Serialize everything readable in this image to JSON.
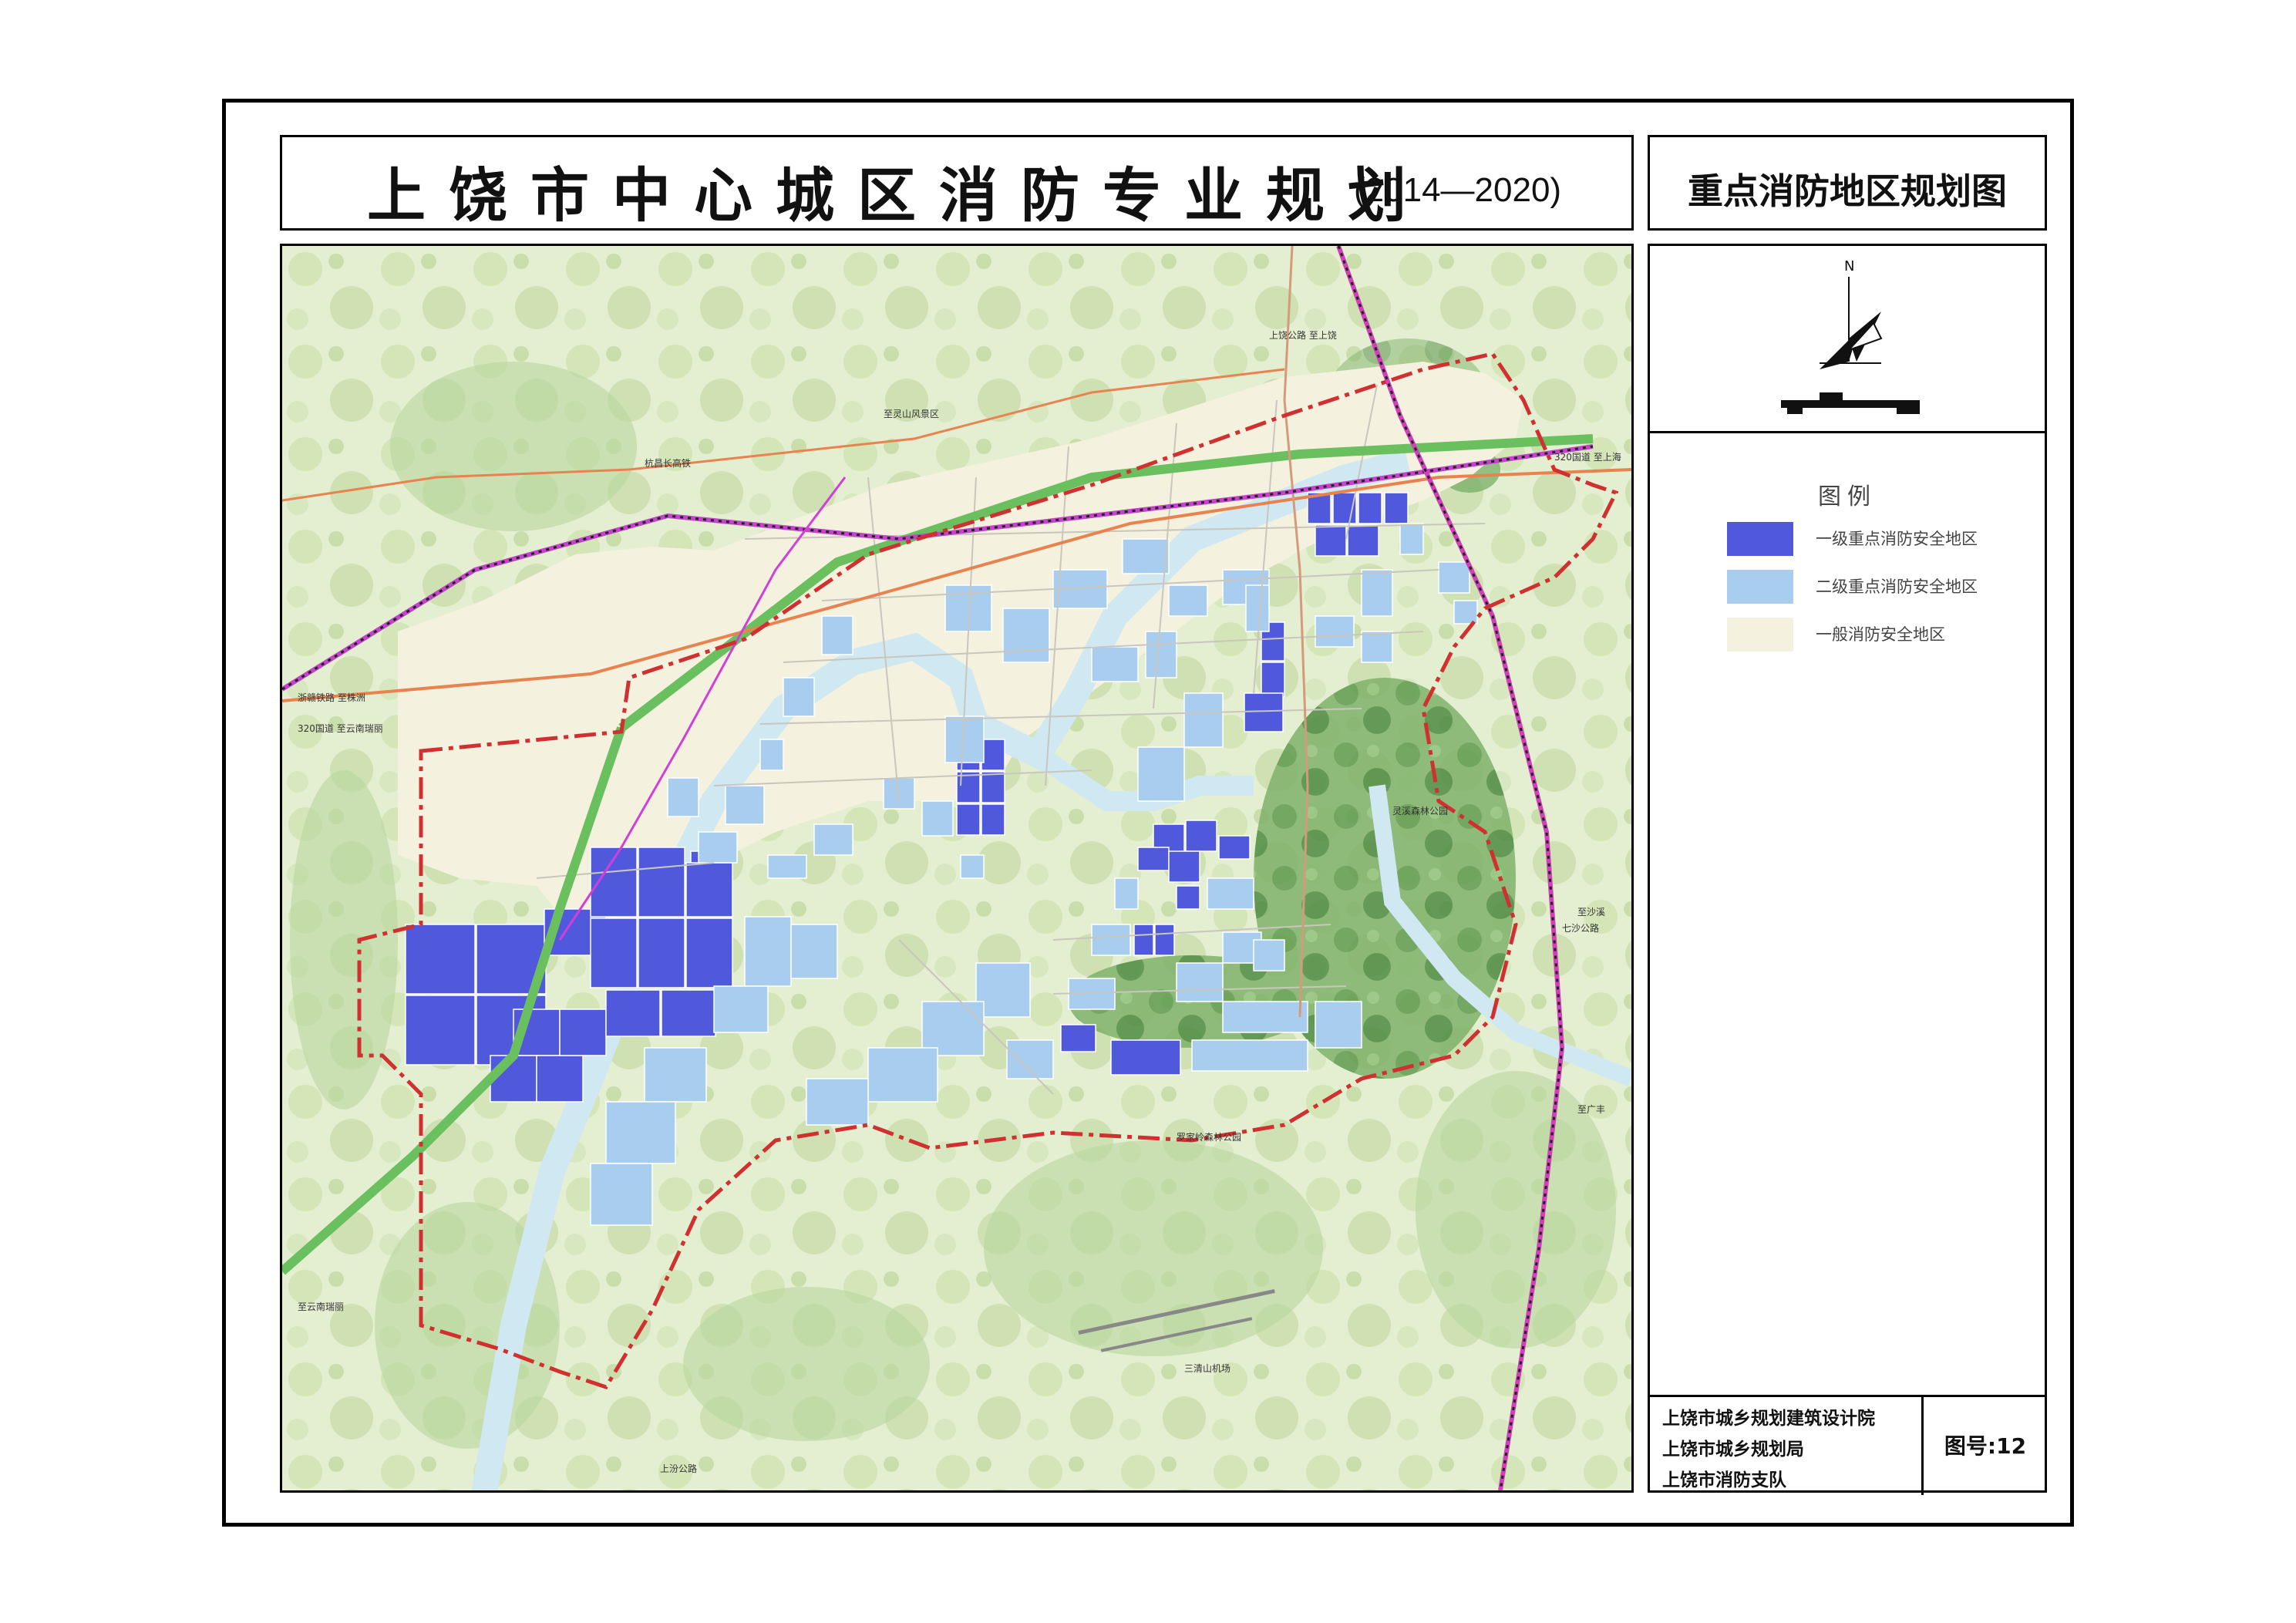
{
  "header": {
    "title": "上饶市中心城区消防专业规划",
    "years": "(2014—2020)",
    "subtitle": "重点消防地区规划图"
  },
  "compass": {
    "label": "N"
  },
  "legend": {
    "title": "图例",
    "items": [
      {
        "label": "一级重点消防安全地区",
        "color": "#5058dc"
      },
      {
        "label": "二级重点消防安全地区",
        "color": "#a9cdef"
      },
      {
        "label": "一般消防安全地区",
        "color": "#f4f2df"
      }
    ]
  },
  "footer": {
    "organizations": [
      "上饶市城乡规划建筑设计院",
      "上饶市城乡规划局",
      "上饶市消防支队"
    ],
    "figure_number": "图号:12"
  },
  "map": {
    "labels": {
      "lingshan": "至灵山风景区",
      "hangchang": "杭昌长高铁",
      "zhegan_rail": "浙赣铁路 至株洲",
      "g320_west": "320国道 至云南瑞丽",
      "g320_east": "320国道 至上海",
      "qisha": "七沙公路",
      "zhisha": "至沙溪",
      "zhiguangfeng": "至广丰",
      "sanqingshan": "三清山机场",
      "luojiayin": "罗家岭森林公园",
      "shangfen": "上汾公路",
      "lingxi": "灵溪森林公园",
      "shangwu_road": "上饶公路 至上饶",
      "zhiyunnan_ruili": "至云南瑞丽"
    }
  }
}
